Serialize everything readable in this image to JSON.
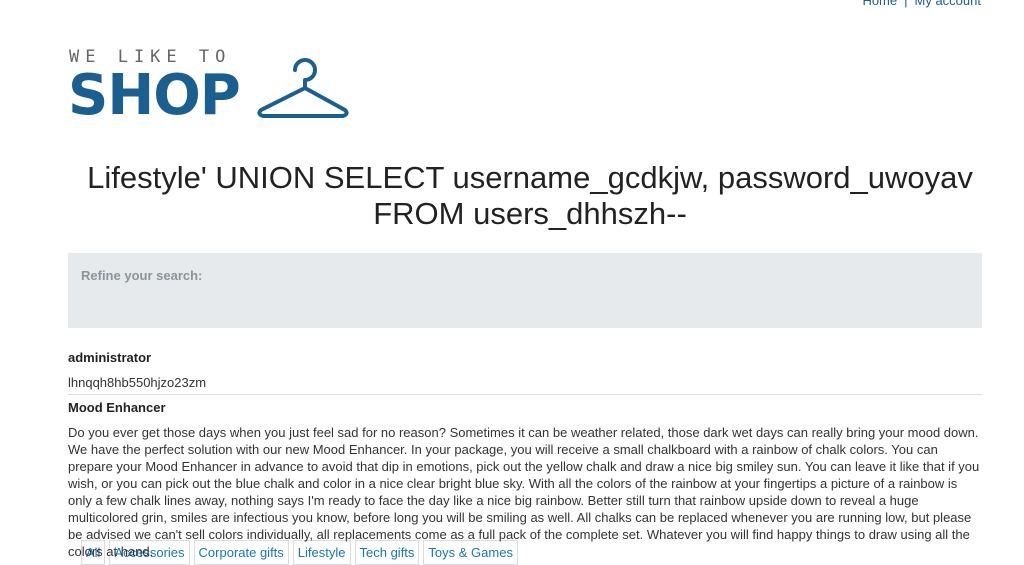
{
  "nav": {
    "home": "Home",
    "separator": "|",
    "account": "My account"
  },
  "logo": {
    "tagline": "WE LIKE TO",
    "brand": "SHOP"
  },
  "page_title": "Lifestyle' UNION SELECT username_gcdkjw, password_uwoyav FROM users_dhhszh--",
  "filters": {
    "label": "Refine your search:",
    "categories": [
      "All",
      "Accessories",
      "Corporate gifts",
      "Lifestyle",
      "Tech gifts",
      "Toys & Games"
    ]
  },
  "results": {
    "user": {
      "username": "administrator",
      "password": "lhnqqh8hb550hjzo23zm"
    },
    "product": {
      "name": "Mood Enhancer",
      "description": "Do you ever get those days when you just feel sad for no reason? Sometimes it can be weather related, those dark wet days can really bring your mood down. We have the perfect solution with our new Mood Enhancer. In your package, you will receive a small chalkboard with a rainbow of chalk colors. You can prepare your Mood Enhancer in advance to avoid that dip in emotions, pick out the yellow chalk and draw a nice big smiley sun. You can leave it like that if you wish, or you can pick out the blue chalk and color in a nice clear bright blue sky. With all the colors of the rainbow at your fingertips a picture of a rainbow is only a few chalk lines away, nothing says I'm ready to face the day like a nice big rainbow. Better still turn that rainbow upside down to reveal a huge multicolored grin, smiles are infectious you know, before long you will be smiling as well. All chalks can be replaced whenever you are running low, but please be advised we can't sell colors individually, all replacements come as a full pack of the complete set. Whatever you will find happy things to draw using all the colors at hand."
    }
  }
}
